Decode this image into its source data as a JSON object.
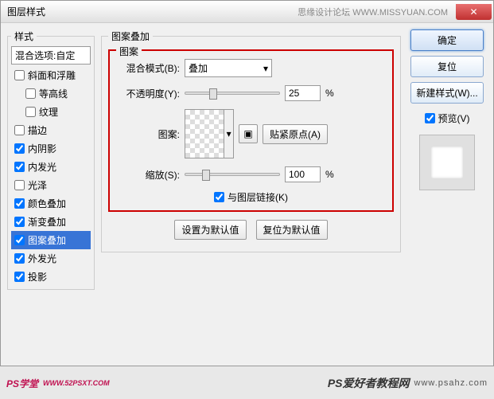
{
  "window": {
    "title": "图层样式",
    "watermark": "思缘设计论坛 WWW.MISSYUAN.COM"
  },
  "left": {
    "legend": "样式",
    "header": "混合选项:自定",
    "items": [
      {
        "label": "斜面和浮雕",
        "checked": false
      },
      {
        "label": "等高线",
        "checked": false,
        "indented": true
      },
      {
        "label": "纹理",
        "checked": false,
        "indented": true
      },
      {
        "label": "描边",
        "checked": false
      },
      {
        "label": "内阴影",
        "checked": true
      },
      {
        "label": "内发光",
        "checked": true
      },
      {
        "label": "光泽",
        "checked": false
      },
      {
        "label": "颜色叠加",
        "checked": true
      },
      {
        "label": "渐变叠加",
        "checked": true
      },
      {
        "label": "图案叠加",
        "checked": true,
        "selected": true
      },
      {
        "label": "外发光",
        "checked": true
      },
      {
        "label": "投影",
        "checked": true
      }
    ]
  },
  "center": {
    "legend": "图案叠加",
    "inner_legend": "图案",
    "blend_label": "混合模式(B):",
    "blend_value": "叠加",
    "opacity_label": "不透明度(Y):",
    "opacity_value": "25",
    "opacity_unit": "%",
    "pattern_label": "图案:",
    "snap_button": "贴紧原点(A)",
    "scale_label": "缩放(S):",
    "scale_value": "100",
    "scale_unit": "%",
    "link_label": "与图层链接(K)",
    "default_btn": "设置为默认值",
    "reset_btn": "复位为默认值"
  },
  "right": {
    "ok": "确定",
    "reset": "复位",
    "new_style": "新建样式(W)...",
    "preview": "预览(V)"
  },
  "footer": {
    "left_name": "PS学堂",
    "left_url": "WWW.52PSXT.COM",
    "right_name": "PS爱好者教程网",
    "right_url": "www.psahz.com"
  }
}
